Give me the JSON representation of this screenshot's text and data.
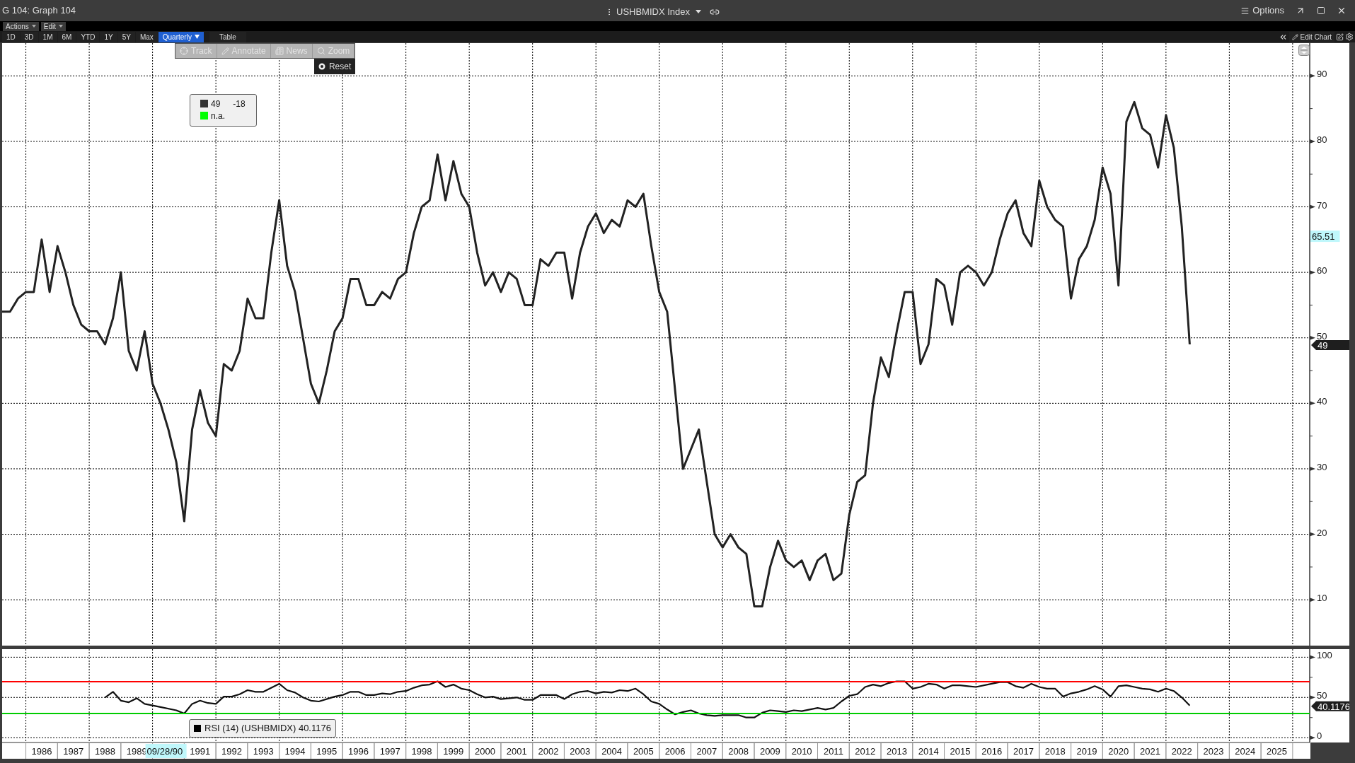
{
  "window": {
    "title": "G 104: Graph 104",
    "security": "USHBMIDX Index",
    "options": "Options"
  },
  "menus": [
    {
      "label": "Actions"
    },
    {
      "label": "Edit"
    }
  ],
  "periods": [
    {
      "label": "1D",
      "selected": false,
      "kind": "button"
    },
    {
      "label": "3D",
      "selected": false,
      "kind": "button"
    },
    {
      "label": "1M",
      "selected": false,
      "kind": "button"
    },
    {
      "label": "6M",
      "selected": false,
      "kind": "button"
    },
    {
      "label": "YTD",
      "selected": false,
      "kind": "button"
    },
    {
      "label": "1Y",
      "selected": false,
      "kind": "button"
    },
    {
      "label": "5Y",
      "selected": false,
      "kind": "button"
    },
    {
      "label": "Max",
      "selected": false,
      "kind": "button"
    },
    {
      "label": "Quarterly",
      "selected": true,
      "kind": "dropdown"
    }
  ],
  "view_button": "Table",
  "edit_chart": "Edit Chart",
  "chart_tools": [
    {
      "label": "Track",
      "disabled": true,
      "kind": "track"
    },
    {
      "label": "Annotate",
      "disabled": true,
      "kind": "annotate"
    },
    {
      "label": "News",
      "disabled": true,
      "kind": "news"
    },
    {
      "label": "Zoom",
      "disabled": true,
      "kind": "zoom"
    }
  ],
  "reset_button": "Reset",
  "legend": [
    {
      "color": "#333333",
      "value": "49",
      "change": "-18"
    },
    {
      "color": "#00ff00",
      "value": "n.a."
    }
  ],
  "main_chart": {
    "cursor_value_tag": "65.51",
    "last_value_tag": "49",
    "chart_data": {
      "type": "line",
      "xlim": [
        1985.25,
        2027.79
      ],
      "ylim": [
        3,
        95
      ],
      "yticks": [
        10,
        20,
        30,
        40,
        50,
        60,
        70,
        80,
        90
      ],
      "x": [
        1985.25,
        1985.5,
        1985.75,
        1986,
        1986.25,
        1986.5,
        1986.75,
        1987,
        1987.25,
        1987.5,
        1987.75,
        1988,
        1988.25,
        1988.5,
        1988.75,
        1989,
        1989.25,
        1989.5,
        1989.75,
        1990,
        1990.25,
        1990.5,
        1990.75,
        1991,
        1991.25,
        1991.5,
        1991.75,
        1992,
        1992.25,
        1992.5,
        1992.75,
        1993,
        1993.25,
        1993.5,
        1993.75,
        1994,
        1994.25,
        1994.5,
        1994.75,
        1995,
        1995.25,
        1995.5,
        1995.75,
        1996,
        1996.25,
        1996.5,
        1996.75,
        1997,
        1997.25,
        1997.5,
        1997.75,
        1998,
        1998.25,
        1998.5,
        1998.75,
        1999,
        1999.25,
        1999.5,
        1999.75,
        2000,
        2000.25,
        2000.5,
        2000.75,
        2001,
        2001.25,
        2001.5,
        2001.75,
        2002,
        2002.25,
        2002.5,
        2002.75,
        2003,
        2003.25,
        2003.5,
        2003.75,
        2004,
        2004.25,
        2004.5,
        2004.75,
        2005,
        2005.25,
        2005.5,
        2005.75,
        2006,
        2006.25,
        2006.5,
        2006.75,
        2007,
        2007.25,
        2007.5,
        2007.75,
        2008,
        2008.25,
        2008.5,
        2008.75,
        2009,
        2009.25,
        2009.5,
        2009.75,
        2010,
        2010.25,
        2010.5,
        2010.75,
        2011,
        2011.25,
        2011.5,
        2011.75,
        2012,
        2012.25,
        2012.5,
        2012.75,
        2013,
        2013.25,
        2013.5,
        2013.75,
        2014,
        2014.25,
        2014.5,
        2014.75,
        2015,
        2015.25,
        2015.5,
        2015.75,
        2016,
        2016.25,
        2016.5,
        2016.75,
        2017,
        2017.25,
        2017.5,
        2017.75,
        2018,
        2018.25,
        2018.5,
        2018.75,
        2019,
        2019.25,
        2019.5,
        2019.75,
        2020,
        2020.25,
        2020.5,
        2020.75,
        2021,
        2021.25,
        2021.5,
        2021.75,
        2022,
        2022.25,
        2022.5,
        2022.75
      ],
      "series": [
        {
          "color": "#222222",
          "values": [
            54,
            54,
            56,
            57,
            57,
            65,
            57,
            64,
            60,
            55,
            52,
            51,
            51,
            49,
            53,
            60,
            48,
            45,
            51,
            43,
            40,
            36,
            31,
            22,
            36,
            42,
            37,
            35,
            46,
            45,
            48,
            56,
            53,
            53,
            63,
            71,
            61,
            57,
            50,
            43,
            40,
            45,
            51,
            53,
            59,
            59,
            55,
            55,
            57,
            56,
            59,
            60,
            66,
            70,
            71,
            78,
            71,
            77,
            72,
            70,
            63,
            58,
            60,
            57,
            60,
            59,
            55,
            55,
            62,
            61,
            63,
            63,
            56,
            63,
            67,
            69,
            66,
            68,
            67,
            71,
            70,
            72,
            64,
            57,
            54,
            42,
            30,
            33,
            36,
            28,
            20,
            18,
            20,
            18,
            17,
            9,
            9,
            15,
            19,
            16,
            15,
            16,
            13,
            16,
            17,
            13,
            14,
            23,
            28,
            29,
            40,
            47,
            44,
            51,
            57,
            57,
            46,
            49,
            59,
            58,
            52,
            60,
            61,
            60,
            58,
            60,
            65,
            69,
            71,
            66,
            64,
            74,
            70,
            68,
            67,
            56,
            62,
            64,
            68,
            76,
            72,
            58,
            83,
            86,
            82,
            81,
            76,
            84,
            79,
            67,
            49
          ]
        }
      ],
      "grid": true
    }
  },
  "rsi_panel": {
    "legend": "RSI (14) (USHBMIDX) 40.1176",
    "last_value_tag": "40.1176",
    "chart_data": {
      "type": "line",
      "xlim": [
        1985.25,
        2027.79
      ],
      "ylim": [
        -6,
        110
      ],
      "yticks": [
        0,
        50,
        100
      ],
      "xticks": [
        {
          "value": 1986.5,
          "label": "1986"
        },
        {
          "value": 1987.5,
          "label": "1987"
        },
        {
          "value": 1988.5,
          "label": "1988"
        },
        {
          "value": 1989.5,
          "label": "1989"
        },
        {
          "value": 1991.5,
          "label": "1991"
        },
        {
          "value": 1992.5,
          "label": "1992"
        },
        {
          "value": 1993.5,
          "label": "1993"
        },
        {
          "value": 1994.5,
          "label": "1994"
        },
        {
          "value": 1995.5,
          "label": "1995"
        },
        {
          "value": 1996.5,
          "label": "1996"
        },
        {
          "value": 1997.5,
          "label": "1997"
        },
        {
          "value": 1998.5,
          "label": "1998"
        },
        {
          "value": 1999.5,
          "label": "1999"
        },
        {
          "value": 2000.5,
          "label": "2000"
        },
        {
          "value": 2001.5,
          "label": "2001"
        },
        {
          "value": 2002.5,
          "label": "2002"
        },
        {
          "value": 2003.5,
          "label": "2003"
        },
        {
          "value": 2004.5,
          "label": "2004"
        },
        {
          "value": 2005.5,
          "label": "2005"
        },
        {
          "value": 2006.5,
          "label": "2006"
        },
        {
          "value": 2007.5,
          "label": "2007"
        },
        {
          "value": 2008.5,
          "label": "2008"
        },
        {
          "value": 2009.5,
          "label": "2009"
        },
        {
          "value": 2010.5,
          "label": "2010"
        },
        {
          "value": 2011.5,
          "label": "2011"
        },
        {
          "value": 2012.5,
          "label": "2012"
        },
        {
          "value": 2013.5,
          "label": "2013"
        },
        {
          "value": 2014.5,
          "label": "2014"
        },
        {
          "value": 2015.5,
          "label": "2015"
        },
        {
          "value": 2016.5,
          "label": "2016"
        },
        {
          "value": 2017.5,
          "label": "2017"
        },
        {
          "value": 2018.5,
          "label": "2018"
        },
        {
          "value": 2019.5,
          "label": "2019"
        },
        {
          "value": 2020.5,
          "label": "2020"
        },
        {
          "value": 2021.5,
          "label": "2021"
        },
        {
          "value": 2022.5,
          "label": "2022"
        },
        {
          "value": 2023.5,
          "label": "2023"
        },
        {
          "value": 2024.5,
          "label": "2024"
        },
        {
          "value": 2025.5,
          "label": "2025"
        }
      ],
      "x": [
        1988.5,
        1988.75,
        1989,
        1989.25,
        1989.5,
        1989.75,
        1990.25,
        1990.75,
        1991,
        1991.25,
        1991.5,
        1991.75,
        1992,
        1992.25,
        1992.5,
        1992.75,
        1993,
        1993.25,
        1993.5,
        1994,
        1994.25,
        1994.5,
        1994.75,
        1995,
        1995.25,
        1995.75,
        1996,
        1996.25,
        1996.5,
        1996.75,
        1997,
        1997.25,
        1997.5,
        1997.75,
        1998,
        1998.25,
        1998.5,
        1998.75,
        1999,
        1999.25,
        1999.5,
        1999.75,
        2000,
        2000.25,
        2000.5,
        2000.75,
        2001,
        2001.5,
        2001.75,
        2002,
        2002.25,
        2002.75,
        2003,
        2003.25,
        2003.5,
        2003.75,
        2004,
        2004.25,
        2004.5,
        2004.75,
        2005,
        2005.25,
        2005.5,
        2005.75,
        2006,
        2006.25,
        2006.5,
        2006.75,
        2007,
        2007.25,
        2007.5,
        2007.75,
        2008,
        2008.5,
        2008.75,
        2009,
        2009.25,
        2009.5,
        2009.75,
        2010,
        2010.25,
        2010.5,
        2010.75,
        2011,
        2011.25,
        2011.5,
        2011.75,
        2012,
        2012.25,
        2012.5,
        2012.75,
        2013,
        2013.25,
        2013.5,
        2013.75,
        2014,
        2014.25,
        2014.5,
        2014.75,
        2015,
        2015.25,
        2015.5,
        2015.75,
        2016,
        2016.5,
        2016.75,
        2017,
        2017.25,
        2017.5,
        2017.75,
        2018,
        2018.25,
        2018.5,
        2018.75,
        2019,
        2019.25,
        2019.5,
        2019.75,
        2020,
        2020.25,
        2020.5,
        2020.75,
        2021,
        2021.25,
        2021.5,
        2021.75,
        2022,
        2022.25,
        2022.5,
        2022.75
      ],
      "series": [
        {
          "color": "#111111",
          "values": [
            50,
            57,
            46,
            44,
            49,
            42,
            38,
            34,
            30,
            42,
            46,
            43,
            42,
            51,
            51,
            54,
            59,
            57,
            57,
            67,
            59,
            56,
            50,
            46,
            45,
            51,
            53,
            57,
            57,
            53,
            53,
            55,
            54,
            57,
            58,
            62,
            65,
            66,
            70,
            63,
            66,
            61,
            59,
            54,
            50,
            51,
            48,
            50,
            47,
            47,
            53,
            53,
            48,
            54,
            57,
            58,
            55,
            57,
            56,
            59,
            58,
            61,
            54,
            45,
            42,
            35,
            29,
            32,
            34,
            30,
            28,
            27,
            28,
            28,
            25,
            25,
            31,
            34,
            33,
            32,
            34,
            33,
            35,
            37,
            35,
            37,
            45,
            52,
            54,
            63,
            66,
            64,
            68,
            70,
            70,
            61,
            63,
            67,
            66,
            61,
            65,
            65,
            64,
            63,
            67,
            69,
            69,
            64,
            62,
            67,
            63,
            61,
            61,
            51,
            55,
            57,
            60,
            64,
            60,
            51,
            64,
            65,
            63,
            61,
            60,
            57,
            61,
            58,
            50,
            40
          ]
        }
      ],
      "grid": true
    },
    "threshold_lines": [
      {
        "color": "#ff0000",
        "kind": "overbought"
      },
      {
        "color": "#00cc00",
        "kind": "oversold"
      }
    ]
  },
  "x_axis": {
    "cursor_date": "09/28/90"
  }
}
